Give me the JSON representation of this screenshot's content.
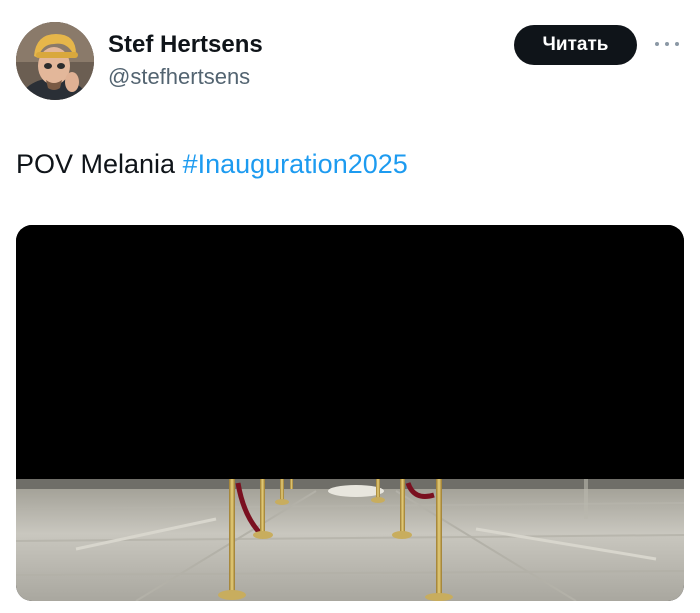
{
  "author": {
    "display_name": "Stef Hertsens",
    "handle": "@stefhertsens",
    "avatar_icon": "profile-photo"
  },
  "actions": {
    "follow_label": "Читать",
    "more_icon": "more-horizontal-icon"
  },
  "post": {
    "text": "POV Melania ",
    "hashtag": "#Inauguration2025"
  },
  "media": {
    "type": "image",
    "description_icon": "photo"
  },
  "colors": {
    "text_primary": "#0f1419",
    "text_secondary": "#536471",
    "link": "#1d9bf0",
    "button_bg": "#0f1419",
    "button_text": "#ffffff"
  }
}
